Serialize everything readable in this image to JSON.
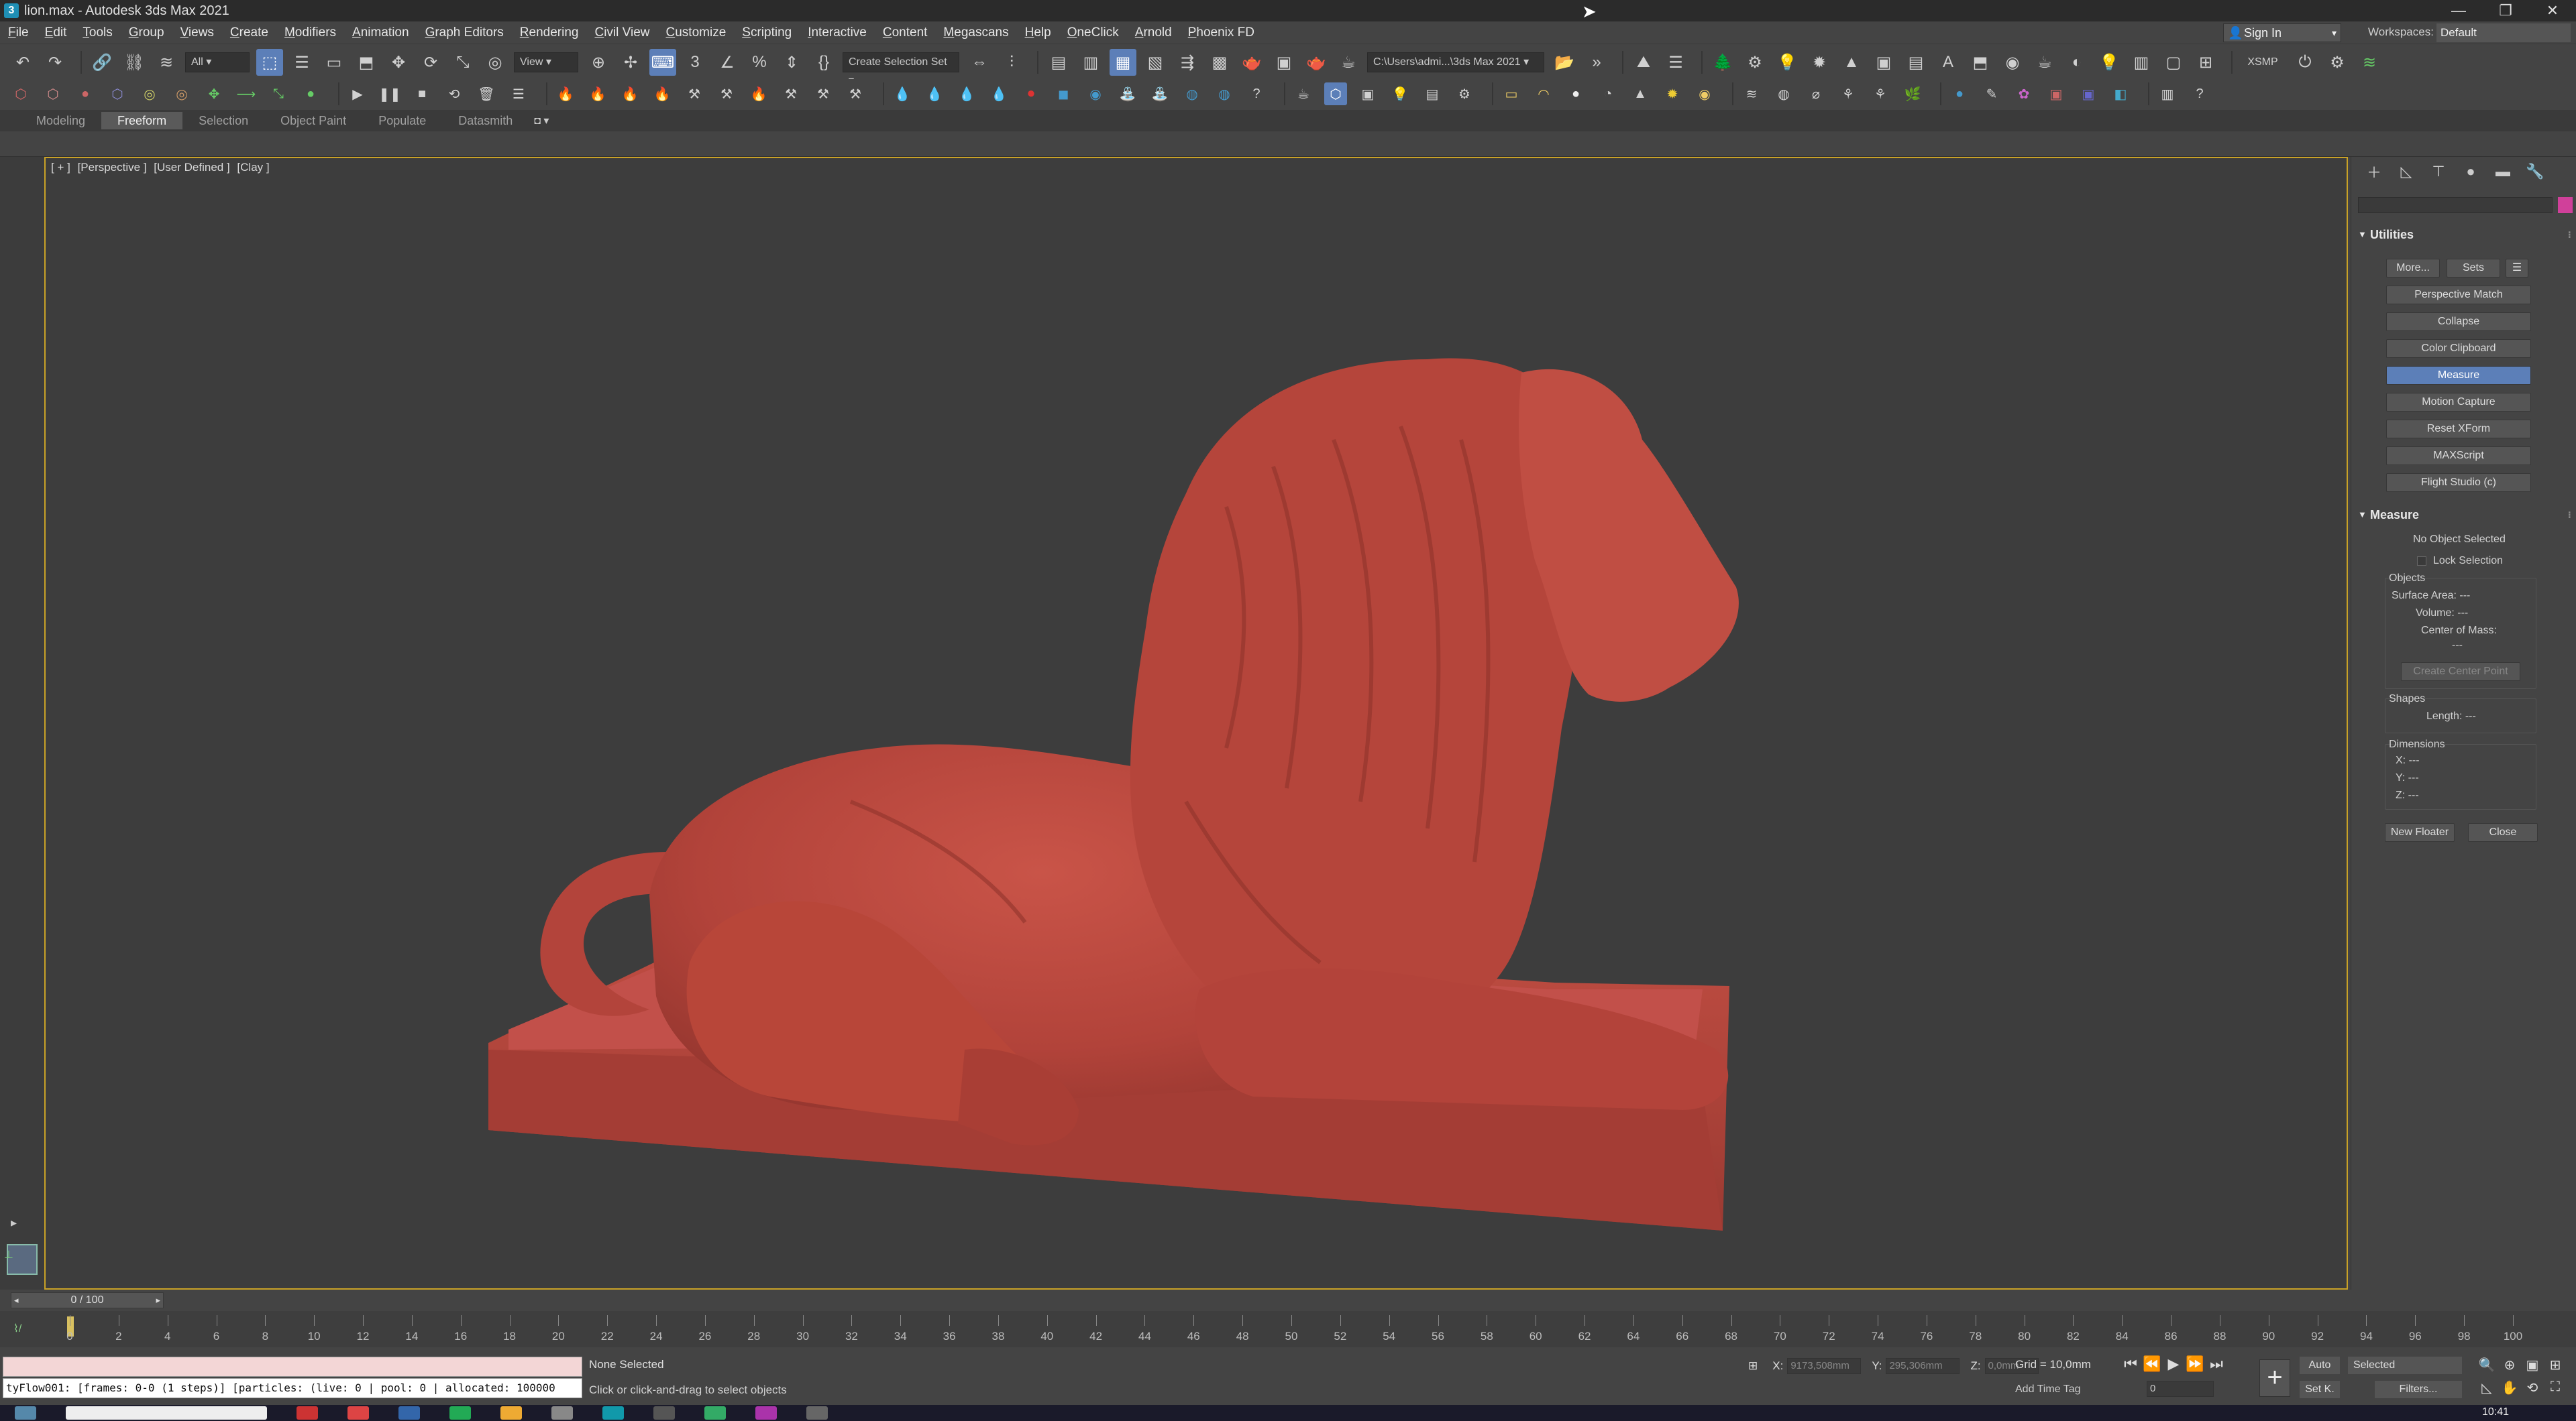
{
  "window": {
    "title": "lion.max - Autodesk 3ds Max 2021",
    "controls": [
      "—",
      "❐",
      "✕"
    ]
  },
  "menu": [
    "File",
    "Edit",
    "Tools",
    "Group",
    "Views",
    "Create",
    "Modifiers",
    "Animation",
    "Graph Editors",
    "Rendering",
    "Civil View",
    "Customize",
    "Scripting",
    "Interactive",
    "Content",
    "Megascans",
    "Help",
    "OneClick",
    "Arnold",
    "Phoenix FD"
  ],
  "signin": "Sign In",
  "workspaces": {
    "label": "Workspaces:",
    "value": "Default"
  },
  "toolbar": {
    "filter": "All",
    "refcoord": "View",
    "selection_set": "Create Selection Set",
    "project_path": "C:\\Users\\admi...\\3ds Max 2021",
    "xsmp": "XSMP"
  },
  "ribbon": {
    "tabs": [
      "Modeling",
      "Freeform",
      "Selection",
      "Object Paint",
      "Populate",
      "Datasmith"
    ],
    "active": "Freeform"
  },
  "viewport": {
    "label": [
      "[ + ]",
      "[Perspective ]",
      "[User Defined ]",
      "[Clay ]"
    ],
    "model_color": "#b9463e"
  },
  "command_panel": {
    "utilities": {
      "title": "Utilities",
      "more": "More...",
      "sets": "Sets",
      "buttons": [
        "Perspective Match",
        "Collapse",
        "Color Clipboard",
        "Measure",
        "Motion Capture",
        "Reset XForm",
        "MAXScript",
        "Flight Studio (c)"
      ],
      "active": "Measure"
    },
    "measure": {
      "title": "Measure",
      "status": "No Object Selected",
      "lock": "Lock Selection",
      "objects": "Objects",
      "surface_area": "Surface Area: ---",
      "volume": "Volume: ---",
      "center_of_mass": "Center of Mass:",
      "com_value": "---",
      "create_center_point": "Create Center Point",
      "shapes": "Shapes",
      "length": "Length: ---",
      "dimensions": "Dimensions",
      "x": "X: ---",
      "y": "Y: ---",
      "z": "Z: ---",
      "new_floater": "New Floater",
      "close": "Close"
    }
  },
  "timeline": {
    "slider": "0 / 100",
    "ticks": [
      "0",
      "2",
      "4",
      "6",
      "8",
      "10",
      "12",
      "14",
      "16",
      "18",
      "20",
      "22",
      "24",
      "26",
      "28",
      "30",
      "32",
      "34",
      "36",
      "38",
      "40",
      "42",
      "44",
      "46",
      "48",
      "50",
      "52",
      "54",
      "56",
      "58",
      "60",
      "62",
      "64",
      "66",
      "68",
      "70",
      "72",
      "74",
      "76",
      "78",
      "80",
      "82",
      "84",
      "86",
      "88",
      "90",
      "92",
      "94",
      "96",
      "98",
      "100"
    ]
  },
  "status": {
    "listener": "tyFlow001: [frames: 0-0 (1 steps)] [particles: (live: 0 | pool: 0 | allocated: 100000",
    "selection": "None Selected",
    "prompt": "Click or click-and-drag to select objects",
    "x_label": "X:",
    "x_value": "9173,508mm",
    "y_label": "Y:",
    "y_value": "295,306mm",
    "z_label": "Z:",
    "z_value": "0,0mm",
    "grid": "Grid = 10,0mm",
    "add_time_tag": "Add Time Tag",
    "frame": "0",
    "auto": "Auto",
    "setk": "Set K.",
    "selected": "Selected",
    "filters": "Filters..."
  },
  "taskbar": {
    "clock": "10:41"
  }
}
